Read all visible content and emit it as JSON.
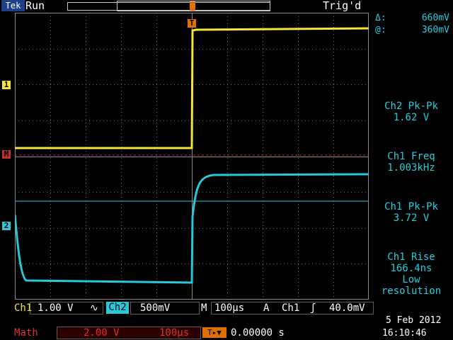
{
  "header": {
    "brand": "Tek",
    "run_state": "Run",
    "trigger_state": "Trig'd"
  },
  "cursor_readouts": {
    "delta_symbol": "Δ:",
    "delta_value": "660mV",
    "abs_symbol": "@:",
    "abs_value": "360mV"
  },
  "measurements": [
    {
      "label": "Ch2 Pk-Pk",
      "value": "1.62 V"
    },
    {
      "label": "Ch1 Freq",
      "value": "1.003kHz"
    },
    {
      "label": "Ch1 Pk-Pk",
      "value": "3.72 V"
    },
    {
      "label": "Ch1 Rise",
      "value": "166.4ns",
      "note1": "Low",
      "note2": "resolution"
    }
  ],
  "status": {
    "ch1_label": "Ch1",
    "ch1_scale": "1.00 V",
    "ch1_coupling": "∿",
    "ch2_label": "Ch2",
    "ch2_scale": "500mV",
    "m_label": "M",
    "timebase": "100µs",
    "a_label": "A",
    "trig_source": "Ch1",
    "trig_slope": "ʃ",
    "trig_level": "40.0mV",
    "math_label": "Math",
    "math_scale": "2.00 V",
    "math_time": "100µs",
    "to_icon": "T▸▼",
    "h_position": "0.00000 s",
    "date": "5 Feb  2012",
    "time": "16:10:46"
  },
  "markers": {
    "ch1": "1",
    "ch2": "2",
    "math": "M",
    "trigger": "T"
  },
  "colors": {
    "ch1": "#f5e43a",
    "ch2": "#27c8d8",
    "math": "#e03030",
    "trigger": "#e07000",
    "grid": "#6a6a6a"
  }
}
